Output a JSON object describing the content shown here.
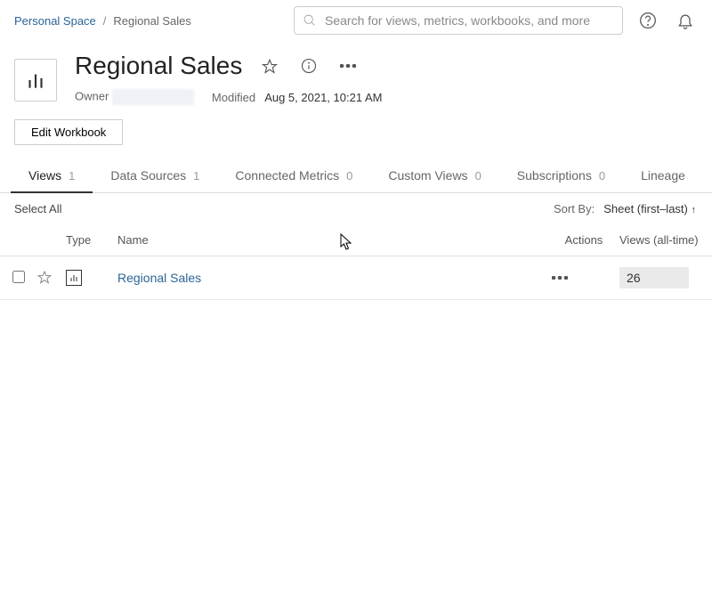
{
  "breadcrumb": {
    "parent": "Personal Space",
    "current": "Regional Sales"
  },
  "search": {
    "placeholder": "Search for views, metrics, workbooks, and more"
  },
  "header": {
    "title": "Regional Sales",
    "owner_label": "Owner",
    "modified_label": "Modified",
    "modified_value": "Aug 5, 2021, 10:21 AM"
  },
  "actions": {
    "edit_workbook": "Edit Workbook"
  },
  "tabs": [
    {
      "label": "Views",
      "count": "1",
      "active": true
    },
    {
      "label": "Data Sources",
      "count": "1",
      "active": false
    },
    {
      "label": "Connected Metrics",
      "count": "0",
      "active": false
    },
    {
      "label": "Custom Views",
      "count": "0",
      "active": false
    },
    {
      "label": "Subscriptions",
      "count": "0",
      "active": false
    },
    {
      "label": "Lineage",
      "count": "",
      "active": false
    }
  ],
  "toolbar": {
    "select_all": "Select All",
    "sort_by_label": "Sort By:",
    "sort_value": "Sheet (first–last)"
  },
  "columns": {
    "type": "Type",
    "name": "Name",
    "actions": "Actions",
    "views": "Views (all-time)"
  },
  "rows": [
    {
      "name": "Regional Sales",
      "views": "26"
    }
  ]
}
